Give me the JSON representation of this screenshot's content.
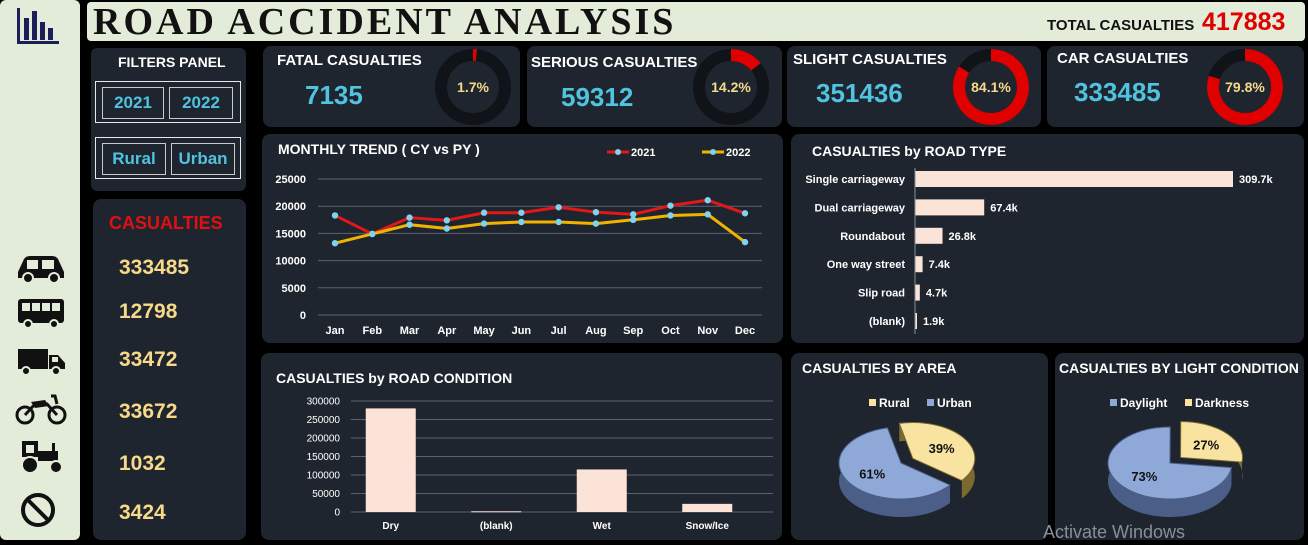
{
  "header": {
    "title": "ROAD ACCIDENT ANALYSIS",
    "total_label": "TOTAL CASUALTIES",
    "total_value": "417883"
  },
  "sidebar_icons": [
    "bar-chart-icon",
    "car-icon",
    "bus-icon",
    "truck-icon",
    "motorcycle-icon",
    "tractor-icon",
    "no-entry-icon"
  ],
  "filters": {
    "title": "FILTERS PANEL",
    "years": [
      "2021",
      "2022"
    ],
    "areas": [
      "Rural",
      "Urban"
    ]
  },
  "kpis": [
    {
      "label": "FATAL CASUALTIES",
      "value": "7135",
      "percent_label": "1.7%",
      "percent": 1.7
    },
    {
      "label": "SERIOUS CASUALTIES",
      "value": "59312",
      "percent_label": "14.2%",
      "percent": 14.2
    },
    {
      "label": "SLIGHT CASUALTIES",
      "value": "351436",
      "percent_label": "84.1%",
      "percent": 84.1
    },
    {
      "label": "CAR CASUALTIES",
      "value": "333485",
      "percent_label": "79.8%",
      "percent": 79.8
    }
  ],
  "casualties_panel": {
    "title": "CASUALTIES",
    "values": [
      "333485",
      "12798",
      "33472",
      "33672",
      "1032",
      "3424"
    ]
  },
  "colors": {
    "accent_red": "#e00000",
    "kpi_cyan": "#4fc3e0",
    "value_yellow": "#f7d98a",
    "series_2021": "#e01818",
    "series_2022": "#f0b400",
    "bar_fill": "#fce3d8",
    "pie_blue": "#8ea8d8",
    "pie_yellow": "#f9e3a0"
  },
  "watermark": "Activate Windows",
  "chart_data": [
    {
      "type": "line",
      "title": "MONTHLY TREND ( CY vs PY )",
      "categories": [
        "Jan",
        "Feb",
        "Mar",
        "Apr",
        "May",
        "Jun",
        "Jul",
        "Aug",
        "Sep",
        "Oct",
        "Nov",
        "Dec"
      ],
      "yticks": [
        "25000",
        "20000",
        "15000",
        "10000",
        "5000",
        "0"
      ],
      "ylim": [
        0,
        25000
      ],
      "grid": true,
      "legend": "top-right",
      "series": [
        {
          "name": "2021",
          "values": [
            18300,
            14900,
            17900,
            17400,
            18800,
            18800,
            19800,
            18900,
            18500,
            20100,
            21100,
            18700
          ]
        },
        {
          "name": "2022",
          "values": [
            13200,
            14900,
            16600,
            15900,
            16800,
            17100,
            17100,
            16800,
            17500,
            18300,
            18500,
            13400
          ]
        }
      ]
    },
    {
      "type": "bar",
      "orientation": "horizontal",
      "title": "CASUALTIES by  ROAD TYPE",
      "categories": [
        "Single carriageway",
        "Dual carriageway",
        "Roundabout",
        "One way street",
        "Slip road",
        "(blank)"
      ],
      "values": [
        309700,
        67400,
        26800,
        7400,
        4700,
        1900
      ],
      "labels": [
        "309.7k",
        "67.4k",
        "26.8k",
        "7.4k",
        "4.7k",
        "1.9k"
      ]
    },
    {
      "type": "bar",
      "title": "CASUALTIES by  ROAD CONDITION",
      "categories": [
        "Dry",
        "(blank)",
        "Wet",
        "Snow/Ice"
      ],
      "values": [
        280000,
        2000,
        115000,
        22000
      ],
      "yticks": [
        "300000",
        "250000",
        "200000",
        "150000",
        "100000",
        "50000",
        "0"
      ],
      "ylim": [
        0,
        300000
      ],
      "grid": true
    },
    {
      "type": "pie",
      "title": "CASUALTIES BY AREA",
      "legend": "top",
      "labels": [
        "Rural",
        "Urban"
      ],
      "values": [
        39,
        61
      ],
      "value_labels": [
        "39%",
        "61%"
      ]
    },
    {
      "type": "pie",
      "title": "CASUALTIES BY LIGHT CONDITION",
      "legend": "top",
      "labels": [
        "Daylight",
        "Darkness"
      ],
      "values": [
        73,
        27
      ],
      "value_labels": [
        "73%",
        "27%"
      ]
    }
  ]
}
